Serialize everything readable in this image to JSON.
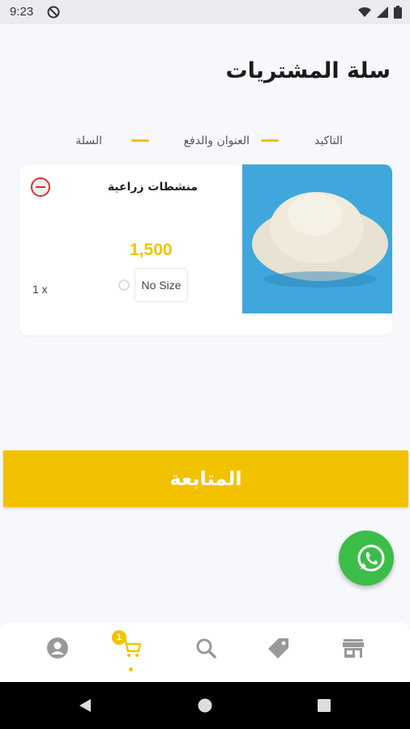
{
  "status_bar": {
    "time": "9:23"
  },
  "page": {
    "title": "سلة المشتريات"
  },
  "steps": [
    {
      "label": "التاكيد"
    },
    {
      "label": "العنوان والدفع"
    },
    {
      "label": "السلة"
    }
  ],
  "cart": {
    "items": [
      {
        "name": "منشطات زراعية",
        "price": "1,500",
        "size": "No Size",
        "quantity": "1 x"
      }
    ]
  },
  "actions": {
    "continue_label": "المتابعة"
  },
  "bottom_nav": {
    "items": [
      {
        "icon": "profile-icon"
      },
      {
        "icon": "cart-icon",
        "badge": "1",
        "active": true
      },
      {
        "icon": "search-icon"
      },
      {
        "icon": "tag-icon"
      },
      {
        "icon": "store-icon"
      }
    ]
  },
  "colors": {
    "accent": "#f2c200",
    "danger": "#e03131",
    "whatsapp": "#3cbd4a",
    "background": "#f6f8fc"
  }
}
